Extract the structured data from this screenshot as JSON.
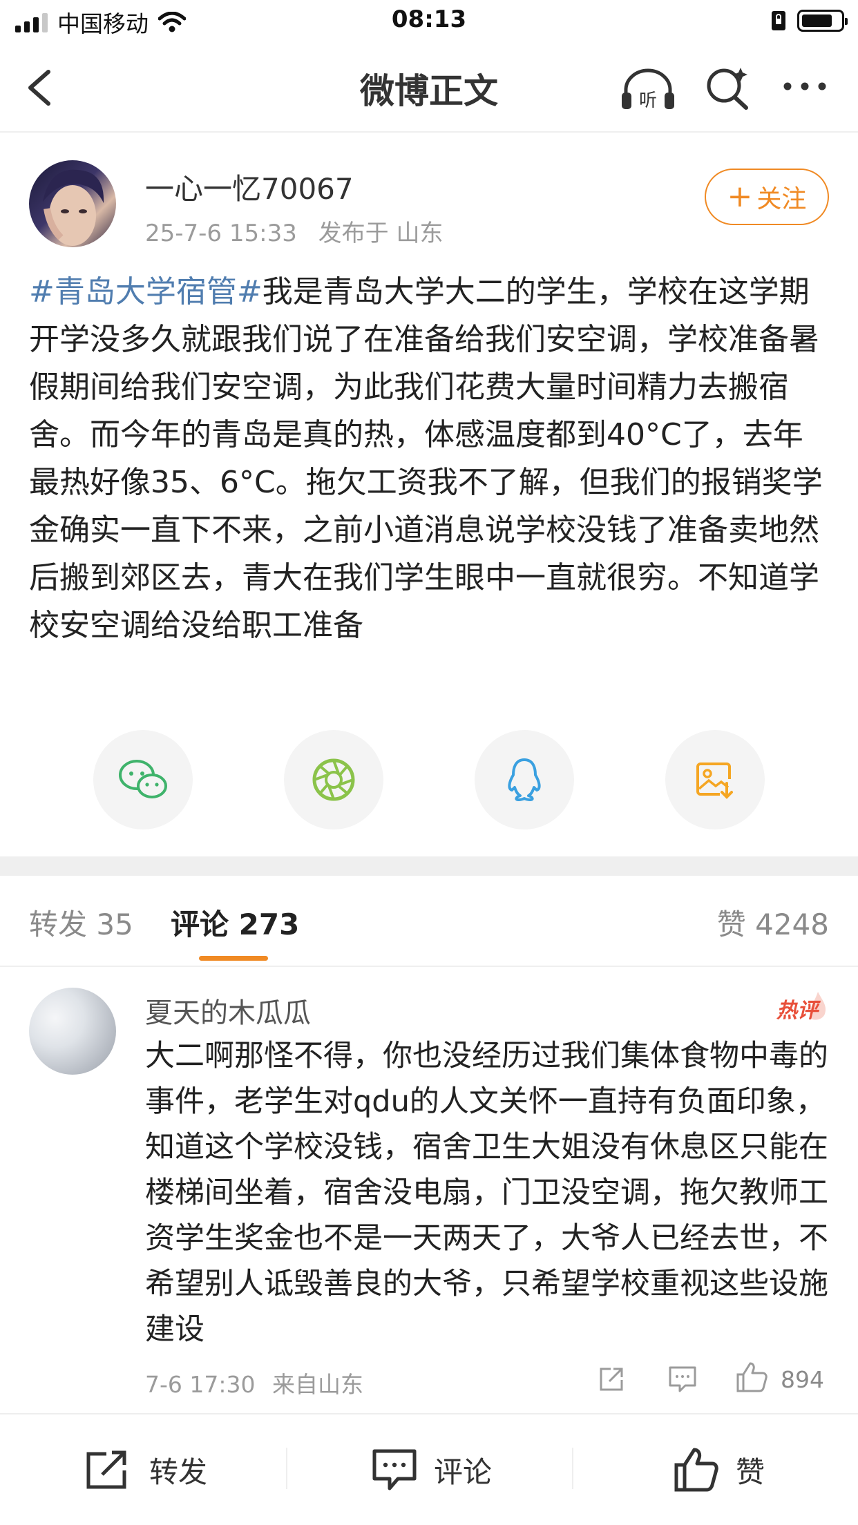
{
  "status_bar": {
    "carrier": "中国移动",
    "time": "08:13"
  },
  "nav": {
    "title": "微博正文",
    "listen_label": "听"
  },
  "post": {
    "username": "一心一忆70067",
    "timestamp": "25-7-6 15:33",
    "location": "发布于 山东",
    "follow_label": "关注",
    "hashtag": "#青岛大学宿管#",
    "body": "我是青岛大学大二的学生，学校在这学期开学没多久就跟我们说了在准备给我们安空调，学校准备暑假期间给我们安空调，为此我们花费大量时间精力去搬宿舍。而今年的青岛是真的热，体感温度都到40°C了，去年最热好像35、6°C。拖欠工资我不了解，但我们的报销奖学金确实一直下不来，之前小道消息说学校没钱了准备卖地然后搬到郊区去，青大在我们学生眼中一直就很穷。不知道学校安空调给没给职工准备"
  },
  "share_icons": [
    "wechat-icon",
    "moments-icon",
    "qq-icon",
    "save-image-icon"
  ],
  "tabs": {
    "repost": "转发 35",
    "comments": "评论 273",
    "likes": "赞 4248"
  },
  "comment": {
    "username": "夏天的木瓜瓜",
    "badge": "热评",
    "text": "大二啊那怪不得，你也没经历过我们集体食物中毒的事件，老学生对qdu的人文关怀一直持有负面印象，知道这个学校没钱，宿舍卫生大姐没有休息区只能在楼梯间坐着，宿舍没电扇，门卫没空调，拖欠教师工资学生奖金也不是一天两天了，大爷人已经去世，不希望别人诋毁善良的大爷，只希望学校重视这些设施建设",
    "time": "7-6 17:30",
    "source": "来自山东",
    "like_count": "894"
  },
  "toolbar": {
    "repost": "转发",
    "comment": "评论",
    "like": "赞"
  },
  "colors": {
    "accent": "#f08a24",
    "hashtag": "#507daf",
    "hot": "#e8503a"
  }
}
